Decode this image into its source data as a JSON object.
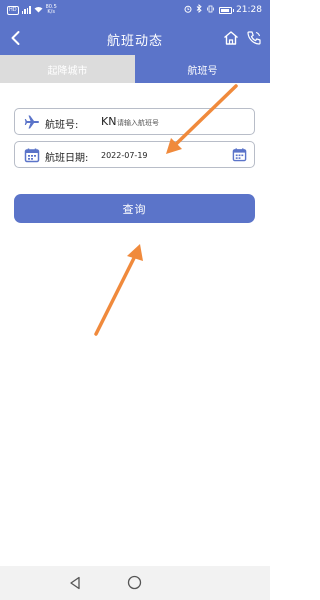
{
  "status_bar": {
    "network_badge": "HD",
    "speed_value": "80.5",
    "speed_unit": "K/s",
    "time": "21:28"
  },
  "header": {
    "title": "航班动态"
  },
  "tabs": [
    {
      "label": "起降城市",
      "active": false
    },
    {
      "label": "航班号",
      "active": true
    }
  ],
  "form": {
    "flight_label": "航班号:",
    "flight_prefix": "KN",
    "flight_value": "",
    "flight_placeholder": "请输入航班号",
    "date_label": "航班日期:",
    "date_value": "2022-07-19"
  },
  "query_button": {
    "label": "查询"
  },
  "icons": {
    "back": "chevron-left-icon",
    "home": "home-icon",
    "phone": "phone-icon",
    "plane": "airplane-icon",
    "calendar": "calendar-icon"
  },
  "colors": {
    "primary": "#5b74c9",
    "tab_inactive": "#dcdcdc",
    "annotation_arrow": "#f08a3c"
  }
}
